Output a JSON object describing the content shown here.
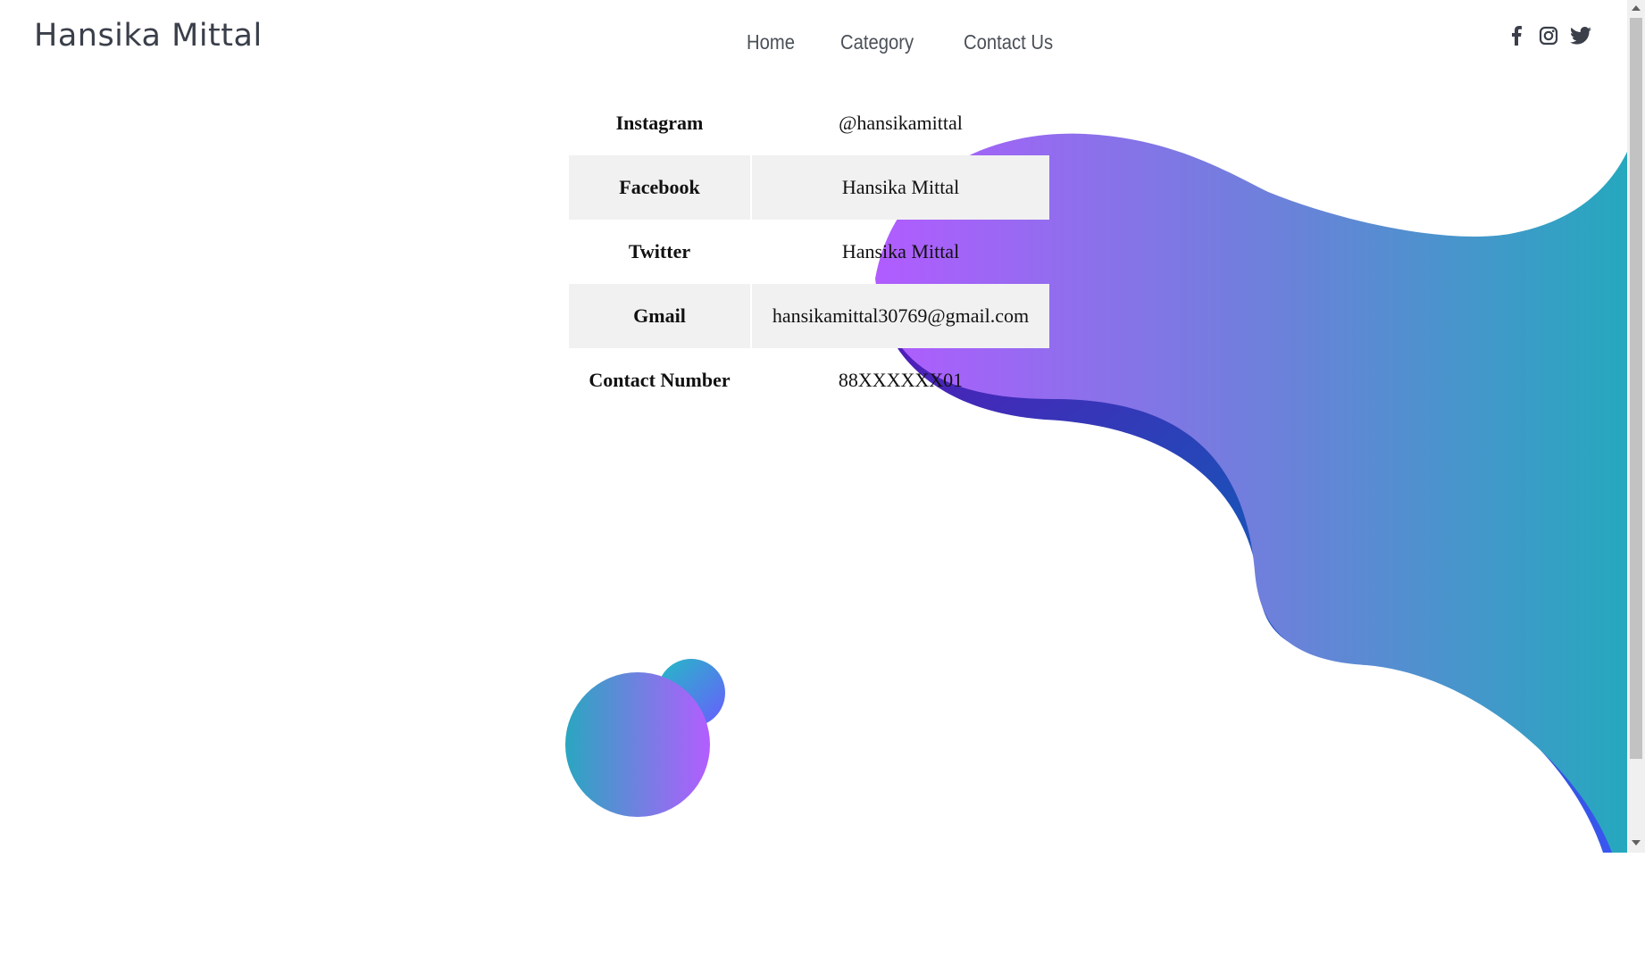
{
  "header": {
    "brand": "Hansika Mittal",
    "nav": [
      "Home",
      "Category",
      "Contact Us"
    ],
    "social_icons": [
      "facebook-icon",
      "instagram-icon",
      "twitter-icon"
    ]
  },
  "contact_table": [
    {
      "label": "Instagram",
      "value": "@hansikamittal"
    },
    {
      "label": "Facebook",
      "value": "Hansika Mittal"
    },
    {
      "label": "Twitter",
      "value": "Hansika Mittal"
    },
    {
      "label": "Gmail",
      "value": "hansikamittal30769@gmail.com"
    },
    {
      "label": "Contact Number",
      "value": "88XXXXXX01"
    }
  ],
  "colors": {
    "gradient_purple": "#b15cff",
    "gradient_teal": "#25a8be",
    "accent_blue": "#1f55d6",
    "accent_violet": "#5a1ab8",
    "text_dark": "#3a3f4a"
  }
}
